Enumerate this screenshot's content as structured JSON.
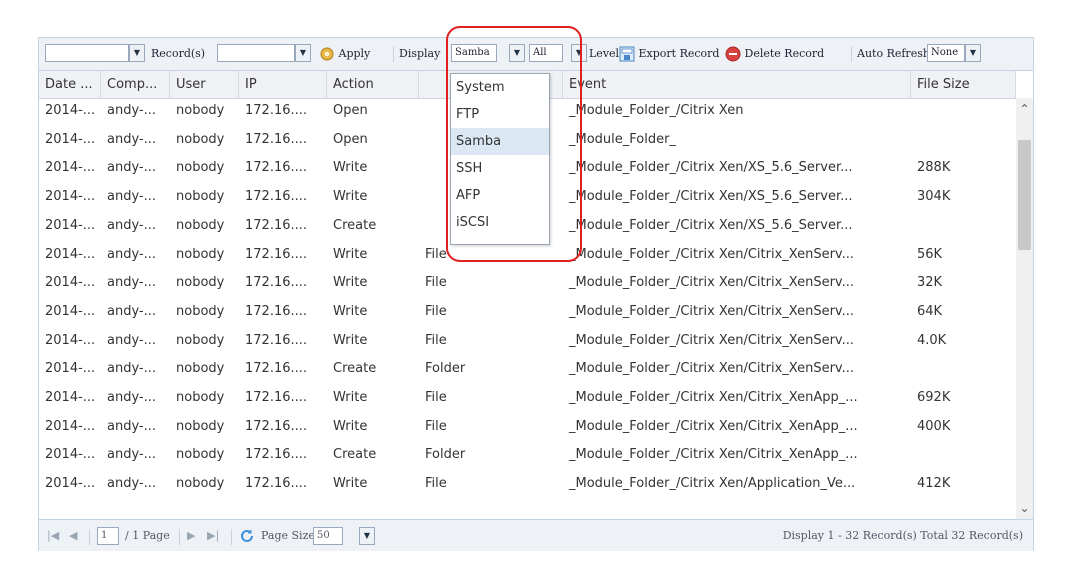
{
  "toolbar": {
    "records_value": "",
    "records_label": "Record(s)",
    "filter_value": "",
    "apply_label": "Apply",
    "display_label": "Display",
    "display_value": "Samba",
    "level_value": "All",
    "level_label": "Level",
    "export_label": "Export Record",
    "delete_label": "Delete Record",
    "auto_refresh_label": "Auto Refresh",
    "auto_refresh_value": "None"
  },
  "columns": [
    "Date ...",
    "Comp...",
    "User",
    "IP",
    "Action",
    "",
    "Event",
    "File Size"
  ],
  "rows": [
    [
      "2014-...",
      "andy-...",
      "nobody",
      "172.16....",
      "Open",
      "",
      "_Module_Folder_/Citrix Xen",
      ""
    ],
    [
      "2014-...",
      "andy-...",
      "nobody",
      "172.16....",
      "Open",
      "",
      "_Module_Folder_",
      ""
    ],
    [
      "2014-...",
      "andy-...",
      "nobody",
      "172.16....",
      "Write",
      "",
      "_Module_Folder_/Citrix Xen/XS_5.6_Server...",
      "288K"
    ],
    [
      "2014-...",
      "andy-...",
      "nobody",
      "172.16....",
      "Write",
      "",
      "_Module_Folder_/Citrix Xen/XS_5.6_Server...",
      "304K"
    ],
    [
      "2014-...",
      "andy-...",
      "nobody",
      "172.16....",
      "Create",
      "",
      "_Module_Folder_/Citrix Xen/XS_5.6_Server...",
      ""
    ],
    [
      "2014-...",
      "andy-...",
      "nobody",
      "172.16....",
      "Write",
      "File",
      "_Module_Folder_/Citrix Xen/Citrix_XenServ...",
      "56K"
    ],
    [
      "2014-...",
      "andy-...",
      "nobody",
      "172.16....",
      "Write",
      "File",
      "_Module_Folder_/Citrix Xen/Citrix_XenServ...",
      "32K"
    ],
    [
      "2014-...",
      "andy-...",
      "nobody",
      "172.16....",
      "Write",
      "File",
      "_Module_Folder_/Citrix Xen/Citrix_XenServ...",
      "64K"
    ],
    [
      "2014-...",
      "andy-...",
      "nobody",
      "172.16....",
      "Write",
      "File",
      "_Module_Folder_/Citrix Xen/Citrix_XenServ...",
      "4.0K"
    ],
    [
      "2014-...",
      "andy-...",
      "nobody",
      "172.16....",
      "Create",
      "Folder",
      "_Module_Folder_/Citrix Xen/Citrix_XenServ...",
      ""
    ],
    [
      "2014-...",
      "andy-...",
      "nobody",
      "172.16....",
      "Write",
      "File",
      "_Module_Folder_/Citrix Xen/Citrix_XenApp_...",
      "692K"
    ],
    [
      "2014-...",
      "andy-...",
      "nobody",
      "172.16....",
      "Write",
      "File",
      "_Module_Folder_/Citrix Xen/Citrix_XenApp_...",
      "400K"
    ],
    [
      "2014-...",
      "andy-...",
      "nobody",
      "172.16....",
      "Create",
      "Folder",
      "_Module_Folder_/Citrix Xen/Citrix_XenApp_...",
      ""
    ],
    [
      "2014-...",
      "andy-...",
      "nobody",
      "172.16....",
      "Write",
      "File",
      "_Module_Folder_/Citrix Xen/Application_Ve...",
      "412K"
    ]
  ],
  "dropdown": {
    "options": [
      "System",
      "FTP",
      "Samba",
      "SSH",
      "AFP",
      "iSCSI"
    ],
    "selected": "Samba"
  },
  "footer": {
    "page_value": "1",
    "page_total": "/ 1 Page",
    "page_size_label": "Page Size",
    "page_size_value": "50",
    "summary": "Display 1 - 32 Record(s) Total 32 Record(s)"
  },
  "colors": {
    "highlight": "#e01f1f",
    "selected_option": "#dce7f4",
    "refresh_icon": "#3a8fd8",
    "delete_icon": "#d94040"
  },
  "icons": [
    "apply-icon",
    "export-icon",
    "delete-icon",
    "refresh-icon",
    "first-page-icon",
    "prev-page-icon",
    "next-page-icon",
    "last-page-icon",
    "scroll-up-icon",
    "scroll-down-icon"
  ]
}
